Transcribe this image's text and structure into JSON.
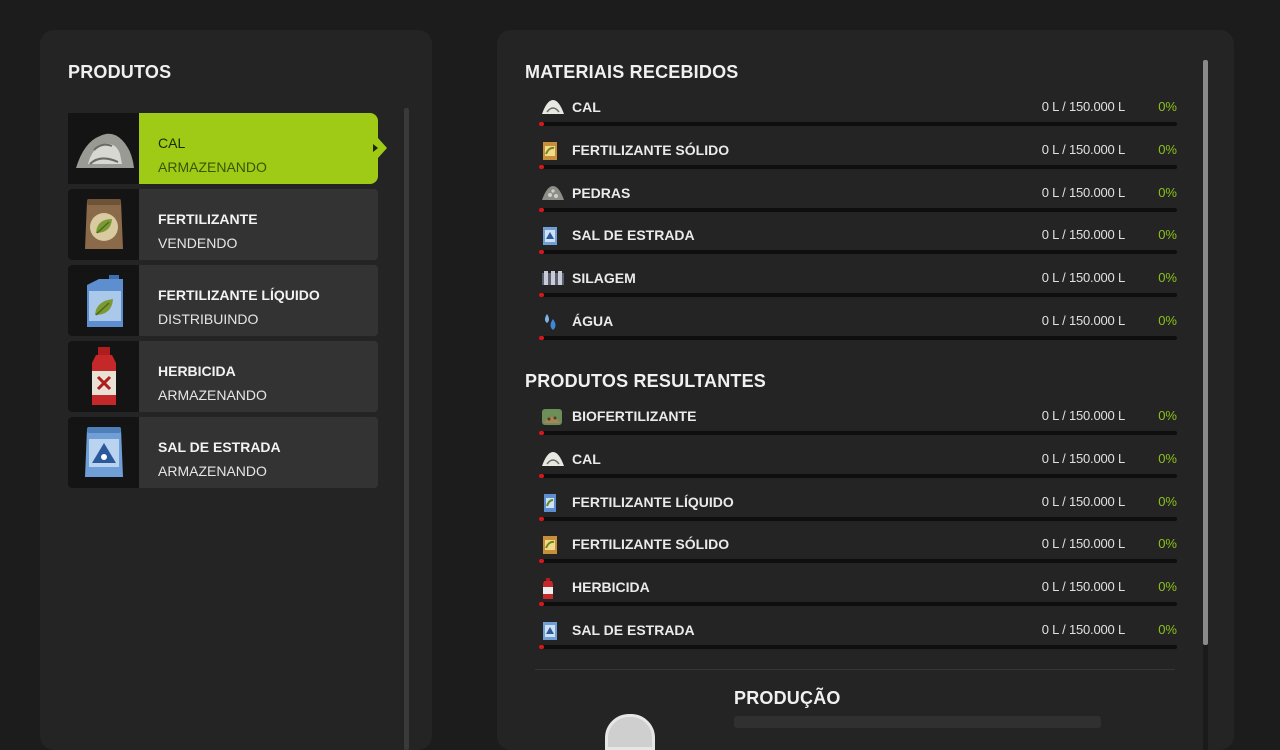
{
  "produtos": {
    "title": "PRODUTOS",
    "items": [
      {
        "name": "CAL",
        "status": "ARMAZENANDO",
        "selected": true,
        "icon": "lime-pile-icon"
      },
      {
        "name": "FERTILIZANTE",
        "status": "VENDENDO",
        "icon": "fertilizer-bag-icon"
      },
      {
        "name": "FERTILIZANTE LÍQUIDO",
        "status": "DISTRIBUINDO",
        "icon": "liquid-fertilizer-canister-icon"
      },
      {
        "name": "HERBICIDA",
        "status": "ARMAZENANDO",
        "icon": "herbicide-bottle-icon"
      },
      {
        "name": "SAL DE ESTRADA",
        "status": "ARMAZENANDO",
        "icon": "road-salt-bag-icon"
      }
    ]
  },
  "materiais": {
    "title": "MATERIAIS RECEBIDOS",
    "rows": [
      {
        "label": "CAL",
        "amount": "0 L / 150.000 L",
        "pct": "0%",
        "icon": "lime-icon",
        "fill": 0
      },
      {
        "label": "FERTILIZANTE SÓLIDO",
        "amount": "0 L / 150.000 L",
        "pct": "0%",
        "icon": "solid-fertilizer-icon",
        "fill": 0
      },
      {
        "label": "PEDRAS",
        "amount": "0 L / 150.000 L",
        "pct": "0%",
        "icon": "stones-icon",
        "fill": 0
      },
      {
        "label": "SAL DE ESTRADA",
        "amount": "0 L / 150.000 L",
        "pct": "0%",
        "icon": "road-salt-icon",
        "fill": 0
      },
      {
        "label": "SILAGEM",
        "amount": "0 L / 150.000 L",
        "pct": "0%",
        "icon": "silage-icon",
        "fill": 0
      },
      {
        "label": "ÁGUA",
        "amount": "0 L / 150.000 L",
        "pct": "0%",
        "icon": "water-drops-icon",
        "fill": 0
      }
    ]
  },
  "resultantes": {
    "title": "PRODUTOS RESULTANTES",
    "rows": [
      {
        "label": "BIOFERTILIZANTE",
        "amount": "0 L / 150.000 L",
        "pct": "0%",
        "icon": "biofertilizer-icon",
        "fill": 0
      },
      {
        "label": "CAL",
        "amount": "0 L / 150.000 L",
        "pct": "0%",
        "icon": "lime-icon",
        "fill": 0
      },
      {
        "label": "FERTILIZANTE LÍQUIDO",
        "amount": "0 L / 150.000 L",
        "pct": "0%",
        "icon": "liquid-fertilizer-icon",
        "fill": 0
      },
      {
        "label": "FERTILIZANTE SÓLIDO",
        "amount": "0 L / 150.000 L",
        "pct": "0%",
        "icon": "solid-fertilizer-icon",
        "fill": 0
      },
      {
        "label": "HERBICIDA",
        "amount": "0 L / 150.000 L",
        "pct": "0%",
        "icon": "herbicide-icon",
        "fill": 0
      },
      {
        "label": "SAL DE ESTRADA",
        "amount": "0 L / 150.000 L",
        "pct": "0%",
        "icon": "road-salt-icon",
        "fill": 0
      }
    ]
  },
  "producao": {
    "title": "PRODUÇÃO"
  },
  "colors": {
    "accent": "#9fcb17",
    "percent": "#8cc21a",
    "bar_marker": "#d8171c"
  }
}
